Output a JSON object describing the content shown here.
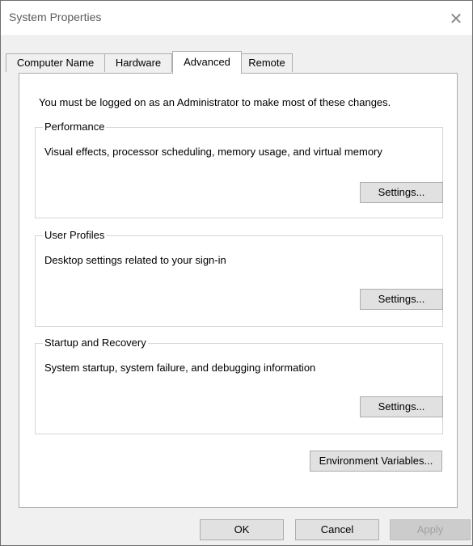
{
  "window": {
    "title": "System Properties",
    "close_glyph": "✕"
  },
  "tabs": [
    {
      "label": "Computer Name",
      "active": false
    },
    {
      "label": "Hardware",
      "active": false
    },
    {
      "label": "Advanced",
      "active": true
    },
    {
      "label": "Remote",
      "active": false
    }
  ],
  "advanced": {
    "admin_note": "You must be logged on as an Administrator to make most of these changes.",
    "performance": {
      "title": "Performance",
      "description": "Visual effects, processor scheduling, memory usage, and virtual memory",
      "button": "Settings..."
    },
    "user_profiles": {
      "title": "User Profiles",
      "description": "Desktop settings related to your sign-in",
      "button": "Settings..."
    },
    "startup_recovery": {
      "title": "Startup and Recovery",
      "description": "System startup, system failure, and debugging information",
      "button": "Settings..."
    },
    "env_button": "Environment Variables..."
  },
  "footer": {
    "ok": "OK",
    "cancel": "Cancel",
    "apply": "Apply",
    "apply_disabled": true
  }
}
